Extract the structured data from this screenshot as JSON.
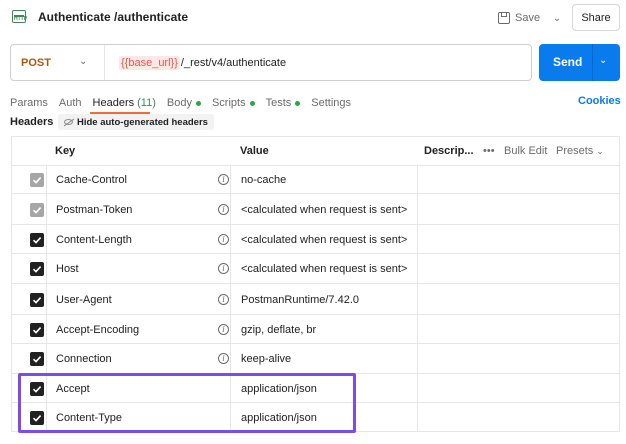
{
  "titlebar": {
    "icon_text": "HTTP",
    "title": "Authenticate /authenticate",
    "save_label": "Save",
    "share_label": "Share"
  },
  "urlbar": {
    "method": "POST",
    "url_variable": "{{base_url}}",
    "url_path": "/_rest/v4/authenticate",
    "send_label": "Send"
  },
  "tabs": {
    "params": "Params",
    "auth": "Auth",
    "headers": "Headers",
    "headers_count": "(11)",
    "body": "Body",
    "scripts": "Scripts",
    "tests": "Tests",
    "settings": "Settings",
    "cookies": "Cookies",
    "dot_color": "#28a745"
  },
  "headers_bar": {
    "label": "Headers",
    "hide_auto": "Hide auto-generated headers"
  },
  "table": {
    "col_key": "Key",
    "col_value": "Value",
    "col_description": "Descrip...",
    "more": "•••",
    "bulk_edit": "Bulk Edit",
    "presets": "Presets",
    "rows": [
      {
        "key": "Cache-Control",
        "value": "no-cache",
        "auto": true,
        "info": true
      },
      {
        "key": "Postman-Token",
        "value": "<calculated when request is sent>",
        "auto": true,
        "info": true
      },
      {
        "key": "Content-Length",
        "value": "<calculated when request is sent>",
        "auto": false,
        "info": true
      },
      {
        "key": "Host",
        "value": "<calculated when request is sent>",
        "auto": false,
        "info": true
      },
      {
        "key": "User-Agent",
        "value": "PostmanRuntime/7.42.0",
        "auto": false,
        "info": true
      },
      {
        "key": "Accept-Encoding",
        "value": "gzip, deflate, br",
        "auto": false,
        "info": true
      },
      {
        "key": "Connection",
        "value": "keep-alive",
        "auto": false,
        "info": true
      },
      {
        "key": "Accept",
        "value": "application/json",
        "auto": false,
        "info": false
      },
      {
        "key": "Content-Type",
        "value": "application/json",
        "auto": false,
        "info": false
      }
    ]
  },
  "colors": {
    "method": "#a9580b",
    "send": "#097bed",
    "highlight": "#7d4be8",
    "tab_underline": "#f26b3a"
  }
}
